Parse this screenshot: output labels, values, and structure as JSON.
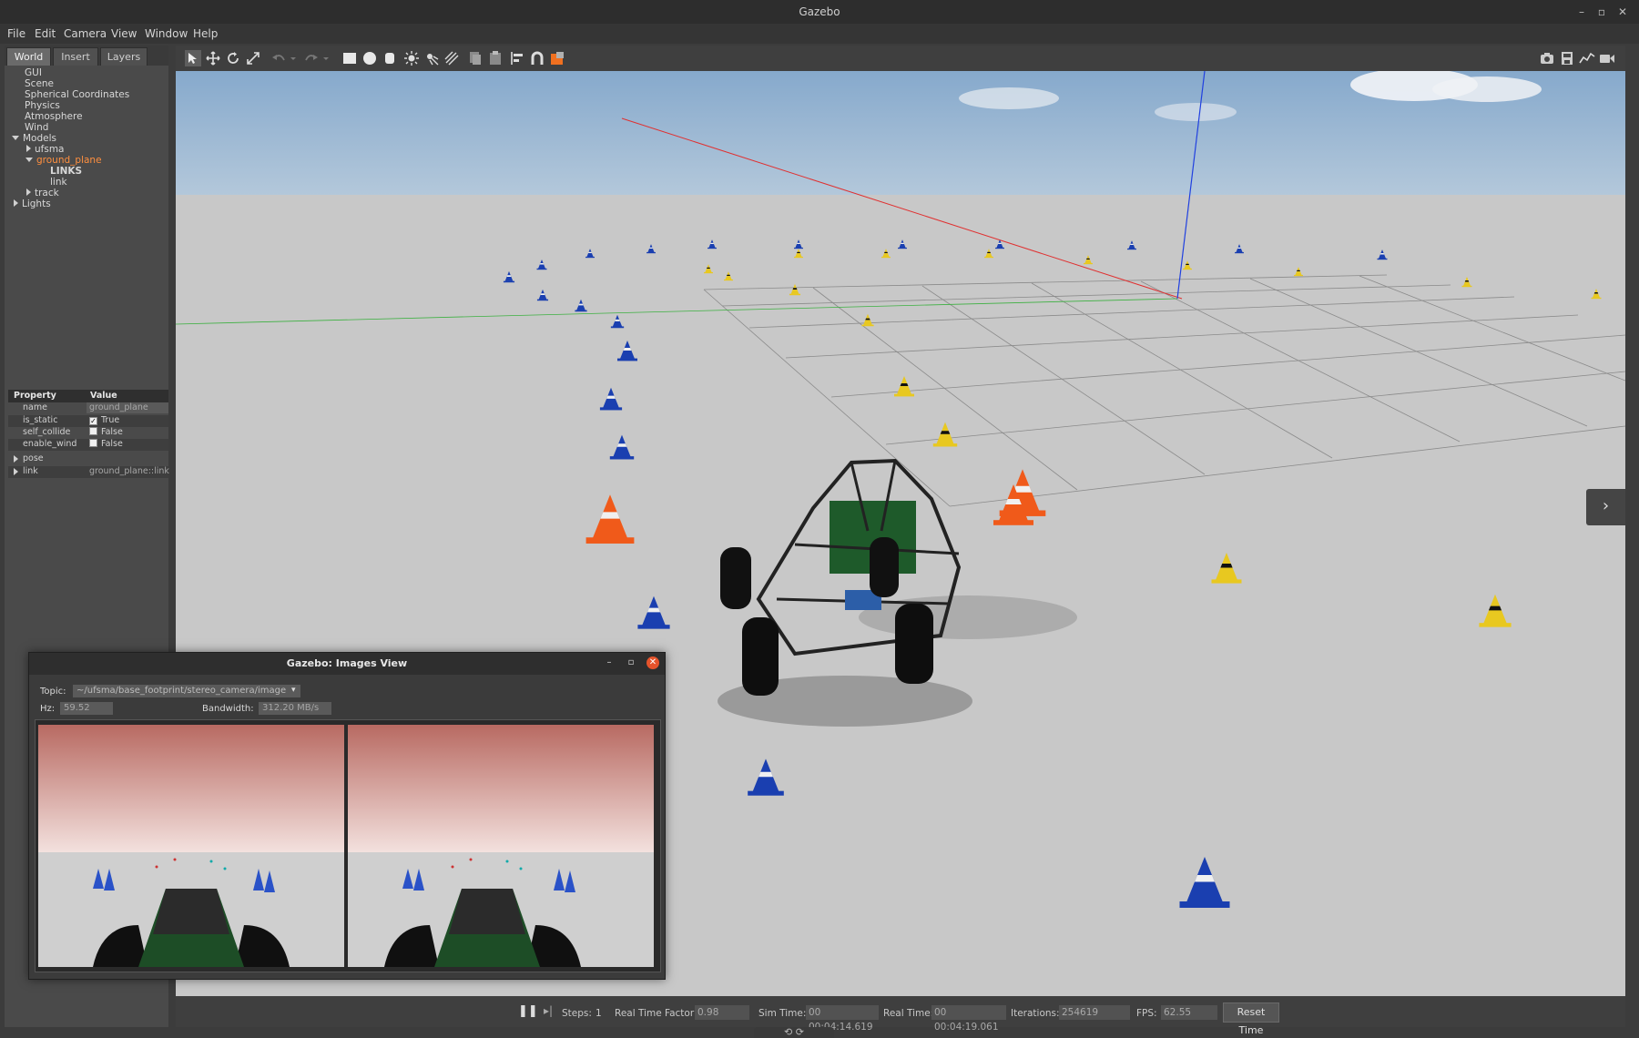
{
  "window": {
    "title": "Gazebo",
    "minimize": "–",
    "maximize": "▫",
    "close": "✕"
  },
  "menu": [
    "File",
    "Edit",
    "Camera",
    "View",
    "Window",
    "Help"
  ],
  "left_panel": {
    "tabs": [
      "World",
      "Insert",
      "Layers"
    ],
    "active_tab": "World",
    "tree": {
      "gui": "GUI",
      "scene": "Scene",
      "spherical": "Spherical Coordinates",
      "physics": "Physics",
      "atmosphere": "Atmosphere",
      "wind": "Wind",
      "models": "Models",
      "ufsma": "ufsma",
      "ground_plane": "ground_plane",
      "links": "LINKS",
      "link": "link",
      "track": "track",
      "lights": "Lights"
    },
    "properties": {
      "header_property": "Property",
      "header_value": "Value",
      "rows": [
        {
          "key": "name",
          "value": "ground_plane"
        },
        {
          "key": "is_static",
          "value": "True",
          "checked": true
        },
        {
          "key": "self_collide",
          "value": "False",
          "checked": false
        },
        {
          "key": "enable_wind",
          "value": "False",
          "checked": false
        }
      ],
      "pose_label": "pose",
      "link_label": "link",
      "link_value": "ground_plane::link"
    }
  },
  "toolbar": {
    "left_icons": [
      "select-mode-icon",
      "translate-mode-icon",
      "rotate-mode-icon",
      "scale-mode-icon",
      "undo-icon",
      "undo-history-icon",
      "redo-icon",
      "redo-history-icon",
      "box-icon",
      "sphere-icon",
      "cylinder-icon",
      "point-light-icon",
      "spot-light-icon",
      "directional-light-icon",
      "copy-icon",
      "paste-icon",
      "align-icon",
      "snap-icon",
      "change-view-icon"
    ],
    "right_icons": [
      "screenshot-icon",
      "log-icon",
      "plot-icon",
      "record-video-icon"
    ]
  },
  "scene_expander": "›",
  "bottom_bar": {
    "pause_icon": "❚❚",
    "step_icon": "▸|",
    "steps_label": "Steps:",
    "steps_value": "1",
    "rtf_label": "Real Time Factor:",
    "rtf_value": "0.98",
    "sim_label": "Sim Time:",
    "sim_value": "00 00:04:14.619",
    "real_label": "Real Time:",
    "real_value": "00 00:04:19.061",
    "iter_label": "Iterations:",
    "iter_value": "254619",
    "fps_label": "FPS:",
    "fps_value": "62.55",
    "reset": "Reset Time",
    "under_icons": "⟲  ⟳"
  },
  "images_view": {
    "title": "Gazebo: Images View",
    "topic_label": "Topic:",
    "topic_value": "~/ufsma/base_footprint/stereo_camera/image",
    "hz_label": "Hz:",
    "hz_value": "59.52",
    "bandwidth_label": "Bandwidth:",
    "bandwidth_value": "312.20 MB/s"
  },
  "colors": {
    "accent_selected": "#ff8f3f",
    "sky": "#9db8d4",
    "ground": "#c8c8c8",
    "cone_blue": "#1a3fb0",
    "cone_yellow": "#e8c820",
    "cone_orange": "#f05a1a",
    "close_red": "#e5532b"
  }
}
